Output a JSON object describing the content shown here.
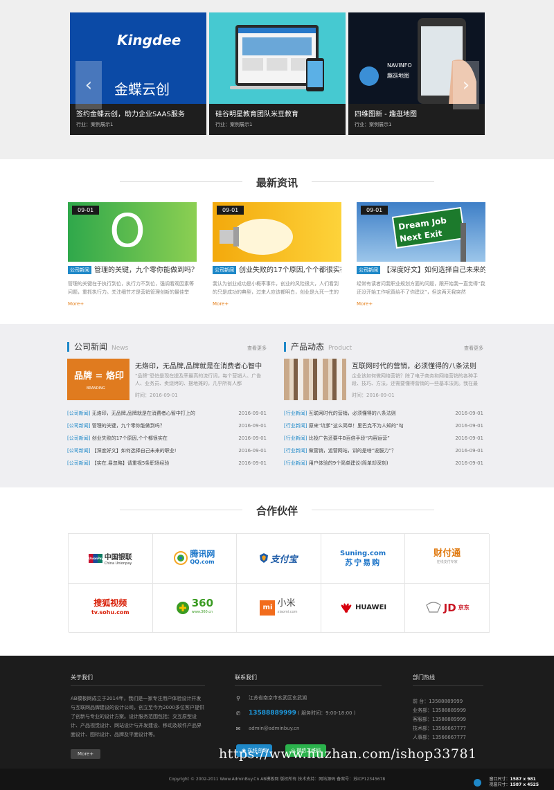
{
  "cases": [
    {
      "title": "签约金蝶云创，助力企业SAAS服务",
      "sub": "行业：案例展示1",
      "brand_en": "Kingdee",
      "brand_cn": "金蝶云创"
    },
    {
      "title": "硅谷明星教育团队米豆教育",
      "sub": "行业：案例展示1"
    },
    {
      "title": "四维图新 - 趣逛地图",
      "sub": "行业：案例展示1",
      "brand_en": "NAVINFO",
      "brand_cn": "趣逛地图"
    }
  ],
  "news_section": {
    "title": "最新资讯",
    "cards": [
      {
        "date": "09-01",
        "tag": "公司新闻",
        "title": "管理的关键，九个零你能做到吗？",
        "desc": "管理的关键在于执行到位，执行力不到位，强调看观因素等问题，重抓执行力。关注细节才是营销管理创新的最佳举",
        "more": "More+",
        "img_text": "O"
      },
      {
        "date": "09-01",
        "tag": "公司新闻",
        "title": "创业失败的17个原因,个个都很实在",
        "desc": "我认为创业成功是小概率事件，创业的风险很大，人们看到的只是成功的典型，过来人应该都明白，创业是九死一生的",
        "more": "More+"
      },
      {
        "date": "09-01",
        "tag": "公司新闻",
        "title": "【深度好文】如何选择自己未来的职业！",
        "desc": "经常有读者问我职业规划方面的问题，跟开始我一直觉得“我还没开始工作呢真给不了你建议”，但这两天我突然",
        "more": "More+",
        "sign1": "Dream Job",
        "sign2": "Next Exit"
      }
    ]
  },
  "company_news": {
    "title": "公司新闻",
    "en": "News",
    "more": "查看更多",
    "feature": {
      "title": "无烙印，无品牌,品牌就是在消费者心智中",
      "desc": "“品牌”恐怕是现在提及率最高的流行词，每个营销人、广告人、业务员、卖烧烤的、摆地摊的，几乎所有人都",
      "time": "时间：2016-09-01",
      "img_text": "品牌 = 烙印",
      "img_sub": "BRANDING"
    },
    "items": [
      {
        "cat": "[公司新闻]",
        "title": "无烙印，无品牌,品牌就是在消费者心智中打上的",
        "date": "2016-09-01"
      },
      {
        "cat": "[公司新闻]",
        "title": "管理的关键，九个零你能做到吗？",
        "date": "2016-09-01"
      },
      {
        "cat": "[公司新闻]",
        "title": "创业失败的17个原因,个个都很实在",
        "date": "2016-09-01"
      },
      {
        "cat": "[公司新闻]",
        "title": "【深度好文】如何选择自己未来的职业!",
        "date": "2016-09-01"
      },
      {
        "cat": "[公司新闻]",
        "title": "【实在.易忽略】请重视5条职场经验",
        "date": "2016-09-01"
      }
    ]
  },
  "product_news": {
    "title": "产品动态",
    "en": "Product",
    "more": "查看更多",
    "feature": {
      "title": "互联网时代的营销，必须懂得的八条法则",
      "desc": "企业该如何做网络营销？除了电子商务和网络营销的各种手段、技巧、方法，还需要懂得营销的一些基本法则。我在最",
      "time": "时间：2016-09-01"
    },
    "items": [
      {
        "cat": "[行业新闻]",
        "title": "互联网时代的营销，必须懂得的八条法则",
        "date": "2016-09-01"
      },
      {
        "cat": "[行业新闻]",
        "title": "原来“坑爹”这么简单！里巴克不为人知的“勾",
        "date": "2016-09-01"
      },
      {
        "cat": "[行业新闻]",
        "title": "比投广告还要牛B百倍手段“内容运营”",
        "date": "2016-09-01"
      },
      {
        "cat": "[行业新闻]",
        "title": "做营销，运营网站，讲的是啥“说服力”？",
        "date": "2016-09-01"
      },
      {
        "cat": "[行业新闻]",
        "title": "用户体验的9个简单建议(简单却深刻)",
        "date": "2016-09-01"
      }
    ]
  },
  "partners": {
    "title": "合作伙伴",
    "logos": [
      {
        "icon": "UnionPay",
        "main": "中国银联",
        "sub": "China Unionpay",
        "color": "#c8102e"
      },
      {
        "icon": "",
        "main": "腾讯网",
        "sub": "QQ.com",
        "color": "#1a75c9"
      },
      {
        "icon": "",
        "main": "支付宝",
        "sub": "",
        "color": "#1c5aa6"
      },
      {
        "icon": "",
        "main": "Suning.com",
        "sub": "苏宁易购",
        "color": "#1a73c8"
      },
      {
        "icon": "",
        "main": "财付通",
        "sub": "在线支付专家",
        "color": "#e07a10"
      },
      {
        "icon": "",
        "main": "搜狐视频",
        "sub": "tv.sohu.com",
        "color": "#d81e06"
      },
      {
        "icon": "",
        "main": "360",
        "sub": "www.360.cn",
        "color": "#3a9b22"
      },
      {
        "icon": "mi",
        "main": "小米",
        "sub": "xiaomi.com",
        "color": "#f26c1c"
      },
      {
        "icon": "",
        "main": "HUAWEI",
        "sub": "",
        "color": "#d7000f"
      },
      {
        "icon": "",
        "main": "JD",
        "sub": "京东",
        "color": "#c91623"
      }
    ]
  },
  "footer": {
    "about": {
      "title": "关于我们",
      "text": "AB模板网成立于2014年，我们是一家专注用户体验设计开发与互联网品牌建设的设计公司，创立至今为2000多位客户提供了创新与专业的设计方案。设计服务范围包括：交互原型设计、产品视觉设计、网站设计与开发建设、移动及软件产品界面设计、图标设计、品牌及平面设计等。",
      "btn": "More+"
    },
    "contact": {
      "title": "联系我们",
      "address": "江苏省南京市玄武区玄武湖",
      "phone": "13588889999",
      "hours": "( 服务时间：9:00-18:00 )",
      "email": "admin@adminbuy.cn",
      "qq_btn": "在线咨询",
      "wx_btn": "微信二维码"
    },
    "hotline": {
      "title": "部门热线",
      "rows": [
        "前 台：13588889999",
        "业务部：13588889999",
        "客服部：13588889999",
        "技术部：13566667777",
        "人事部：13566667777"
      ]
    },
    "copyright": "Copyright © 2002-2011 Www.AdminBuy.Cn AB模板网 版权所有   技术支持：网站源码   备案号：苏ICP12345678",
    "watermark": "https://www.huzhan.com/ishop33781",
    "win_size_label": "窗口尺寸：",
    "win_size": "1587 x 981",
    "view_size_label": "视窗尺寸：",
    "view_size": "1587 x 4525"
  }
}
